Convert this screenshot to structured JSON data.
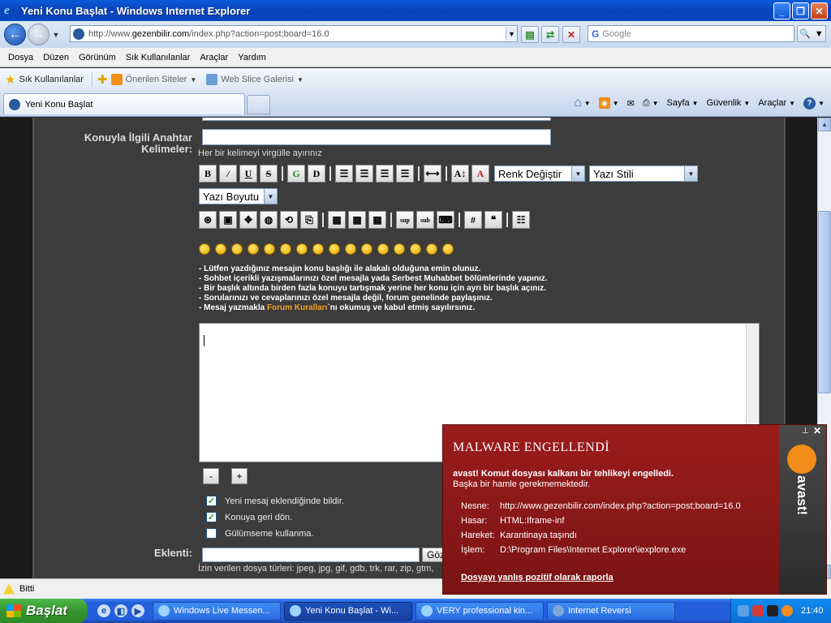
{
  "window": {
    "title": "Yeni Konu Başlat - Windows Internet Explorer"
  },
  "address": {
    "url_prefix": "http://www.",
    "url_domain": "gezenbilir.com",
    "url_rest": "/index.php?action=post;board=16.0"
  },
  "search": {
    "placeholder": "Google"
  },
  "menu": [
    "Dosya",
    "Düzen",
    "Görünüm",
    "Sık Kullanılanlar",
    "Araçlar",
    "Yardım"
  ],
  "favorites": {
    "label": "Sık Kullanılanlar",
    "suggested": "Önerilen Siteler",
    "webslice": "Web Slice Galerisi"
  },
  "tab": {
    "title": "Yeni Konu Başlat"
  },
  "commands": {
    "page": "Sayfa",
    "safety": "Güvenlik",
    "tools": "Araçlar"
  },
  "form": {
    "keywords_label_1": "Konuyla İlgili Anahtar",
    "keywords_label_2": "Kelimeler:",
    "keywords_hint": "Her bir kelimeyi virgülle ayırınız",
    "color_select": "Renk Değiştir",
    "font_select": "Yazı Stili",
    "size_select": "Yazı Boyutu",
    "rules": [
      "- Lütfen yazdığınız mesajın konu başlığı ile alakalı olduğuna emin olunuz.",
      "- Sohbet içerikli yazışmalarınızı özel mesajla yada Serbest Muhabbet bölümlerinde yapınız.",
      "- Bir başlık altında birden fazla konuyu tartışmak yerine her konu için ayrı bir başlık açınız.",
      "- Sorularınızı ve cevaplarınızı özel mesajla değil, forum genelinde paylaşınız."
    ],
    "rule_last_pre": "- Mesaj yazmakla ",
    "rule_last_link": "Forum Kuralları",
    "rule_last_post": "`nı okumuş ve kabul etmiş sayılırsınız.",
    "minus": "-",
    "plus": "+",
    "chk_notify": "Yeni mesaj eklendiğinde bildir.",
    "chk_return": "Konuya geri dön.",
    "chk_nosmiley": "Gülümseme kullanma.",
    "attach_label": "Eklenti:",
    "browse": "Gözat...",
    "allowed_types": "İzin verilen dosya türleri: jpeg, jpg, gif, gdb, trk, rar, zip, gtm,"
  },
  "status": {
    "text": "Bitti"
  },
  "taskbar": {
    "start": "Başlat",
    "tasks": [
      "Windows Live Messen...",
      "Yeni Konu Başlat - Wi...",
      "VERY professional kin...",
      "Internet Reversi"
    ],
    "clock": "21:40"
  },
  "avast": {
    "title": "MALWARE ENGELLENDİ",
    "msg1": "avast! Komut dosyası kalkanı bir tehlikeyi engelledi.",
    "msg2": "Başka bir hamle gerekmemektedir.",
    "object_k": "Nesne:",
    "object_v": "http://www.gezenbilir.com/index.php?action=post;board=16.0",
    "damage_k": "Hasar:",
    "damage_v": "HTML:Iframe-inf",
    "action_k": "Hareket:",
    "action_v": "Karantinaya taşındı",
    "process_k": "İşlem:",
    "process_v": "D:\\Program Files\\Internet Explorer\\iexplore.exe",
    "report": "Dosyayı yanlış pozitif olarak raporla",
    "brand": "avast!"
  }
}
